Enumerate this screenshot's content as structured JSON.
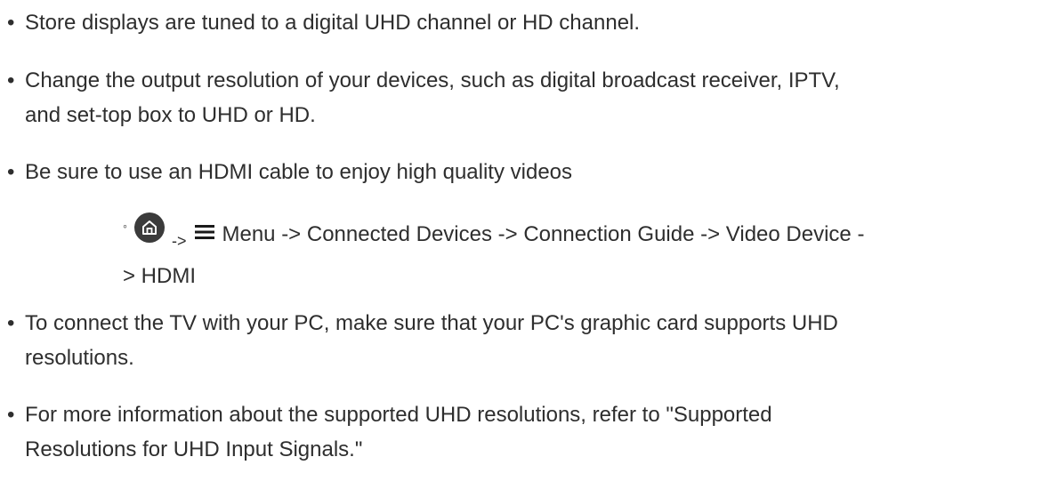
{
  "bullets": {
    "b1": "Store displays are tuned to a digital UHD channel or HD channel.",
    "b2_line1": "Change the output resolution of your devices, such as digital broadcast receiver, IPTV,",
    "b2_line2": "and set-top box to UHD or HD.",
    "b3": "Be sure to use an HDMI cable to enjoy high quality videos",
    "b4_line1": "To connect the TV with your PC, make sure that your PC's graphic card supports UHD",
    "b4_line2": "resolutions.",
    "b5_line1": "For more information about the supported UHD resolutions, refer to \"Supported",
    "b5_line2": "Resolutions for UHD Input Signals.\""
  },
  "subitem": {
    "marker": "◦",
    "arrow1": "->",
    "path_line1": "Menu -> Connected Devices -> Connection Guide -> Video Device -",
    "path_line2": "> HDMI",
    "icons": [
      "home-icon",
      "menu-icon"
    ]
  },
  "bullet_char": "•"
}
